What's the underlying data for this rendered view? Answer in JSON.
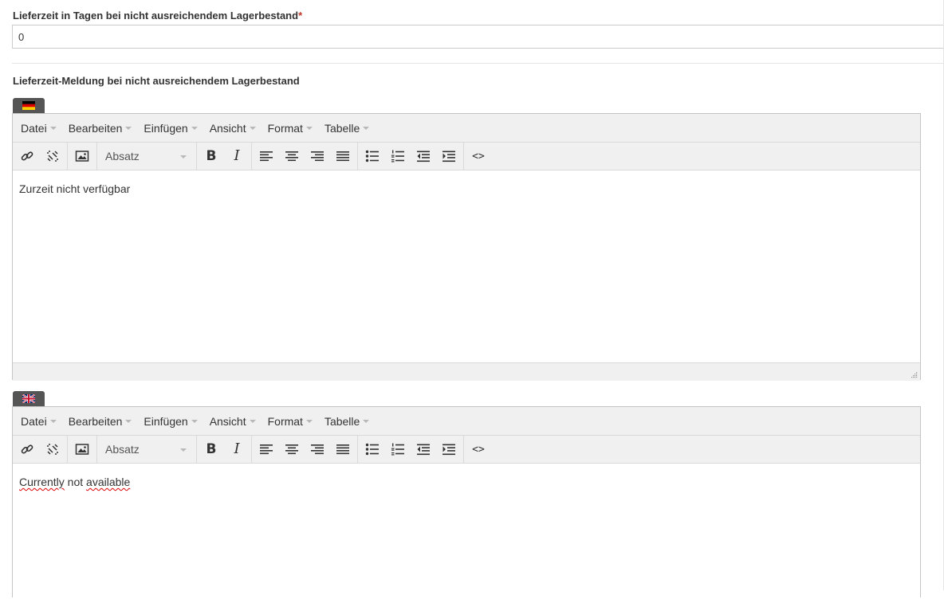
{
  "delivery_days": {
    "label": "Lieferzeit in Tagen bei nicht ausreichendem Lagerbestand",
    "required_mark": "*",
    "value": "0"
  },
  "delivery_message": {
    "label": "Lieferzeit-Meldung bei nicht ausreichendem Lagerbestand"
  },
  "menu": [
    "Datei",
    "Bearbeiten",
    "Einfügen",
    "Ansicht",
    "Format",
    "Tabelle"
  ],
  "toolbar": {
    "format_select": "Absatz",
    "bold_glyph": "B",
    "italic_glyph": "I",
    "source_glyph": "<>"
  },
  "editors": [
    {
      "language_icon": "german-flag-icon",
      "content_words": [
        "Zurzeit nicht verfügbar"
      ]
    },
    {
      "language_icon": "uk-flag-icon",
      "content_words": [
        "Currently",
        " not ",
        "available"
      ],
      "spellcheck_flagged": [
        "Currently",
        "available"
      ]
    }
  ],
  "colors": {
    "required": "#c0392b",
    "toolbar_bg": "#f0f0f0",
    "flag_tab": "#555555",
    "spellcheck": "#dd0000"
  }
}
